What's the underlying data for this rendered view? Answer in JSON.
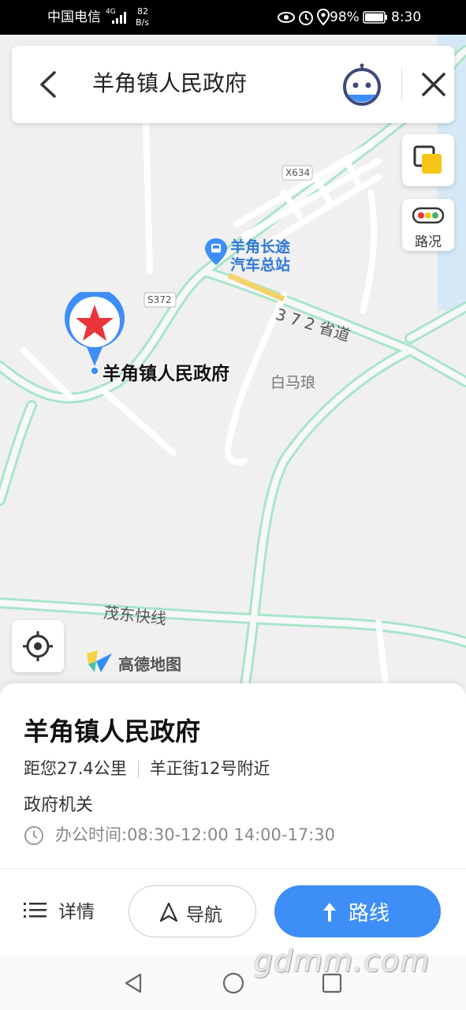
{
  "status_bar": {
    "carrier": "中国电信",
    "network": "4G",
    "speed_value": "82",
    "speed_unit": "B/s",
    "battery": "98%",
    "time": "8:30"
  },
  "search": {
    "query": "羊角镇人民政府"
  },
  "map": {
    "traffic_label": "路况",
    "road_x634": "X634",
    "road_s372": "S372",
    "bus_station_line1": "羊角长途",
    "bus_station_line2": "汽车总站",
    "provincial_road": "3 7 2 省道",
    "village": "白马琅",
    "marker_label": "羊角镇人民政府",
    "expressway": "茂东快线",
    "logo_text": "高德地图"
  },
  "poi": {
    "name": "羊角镇人民政府",
    "distance": "距您27.4公里",
    "address": "羊正街12号附近",
    "category": "政府机关",
    "hours": "办公时间:08:30-12:00 14:00-17:30"
  },
  "actions": {
    "details": "详情",
    "navigate": "导航",
    "route": "路线"
  },
  "watermark": "gdmm.com",
  "colors": {
    "accent": "#3e8ef7",
    "road_green": "#a8e6c9",
    "marker_red": "#e8343a"
  }
}
